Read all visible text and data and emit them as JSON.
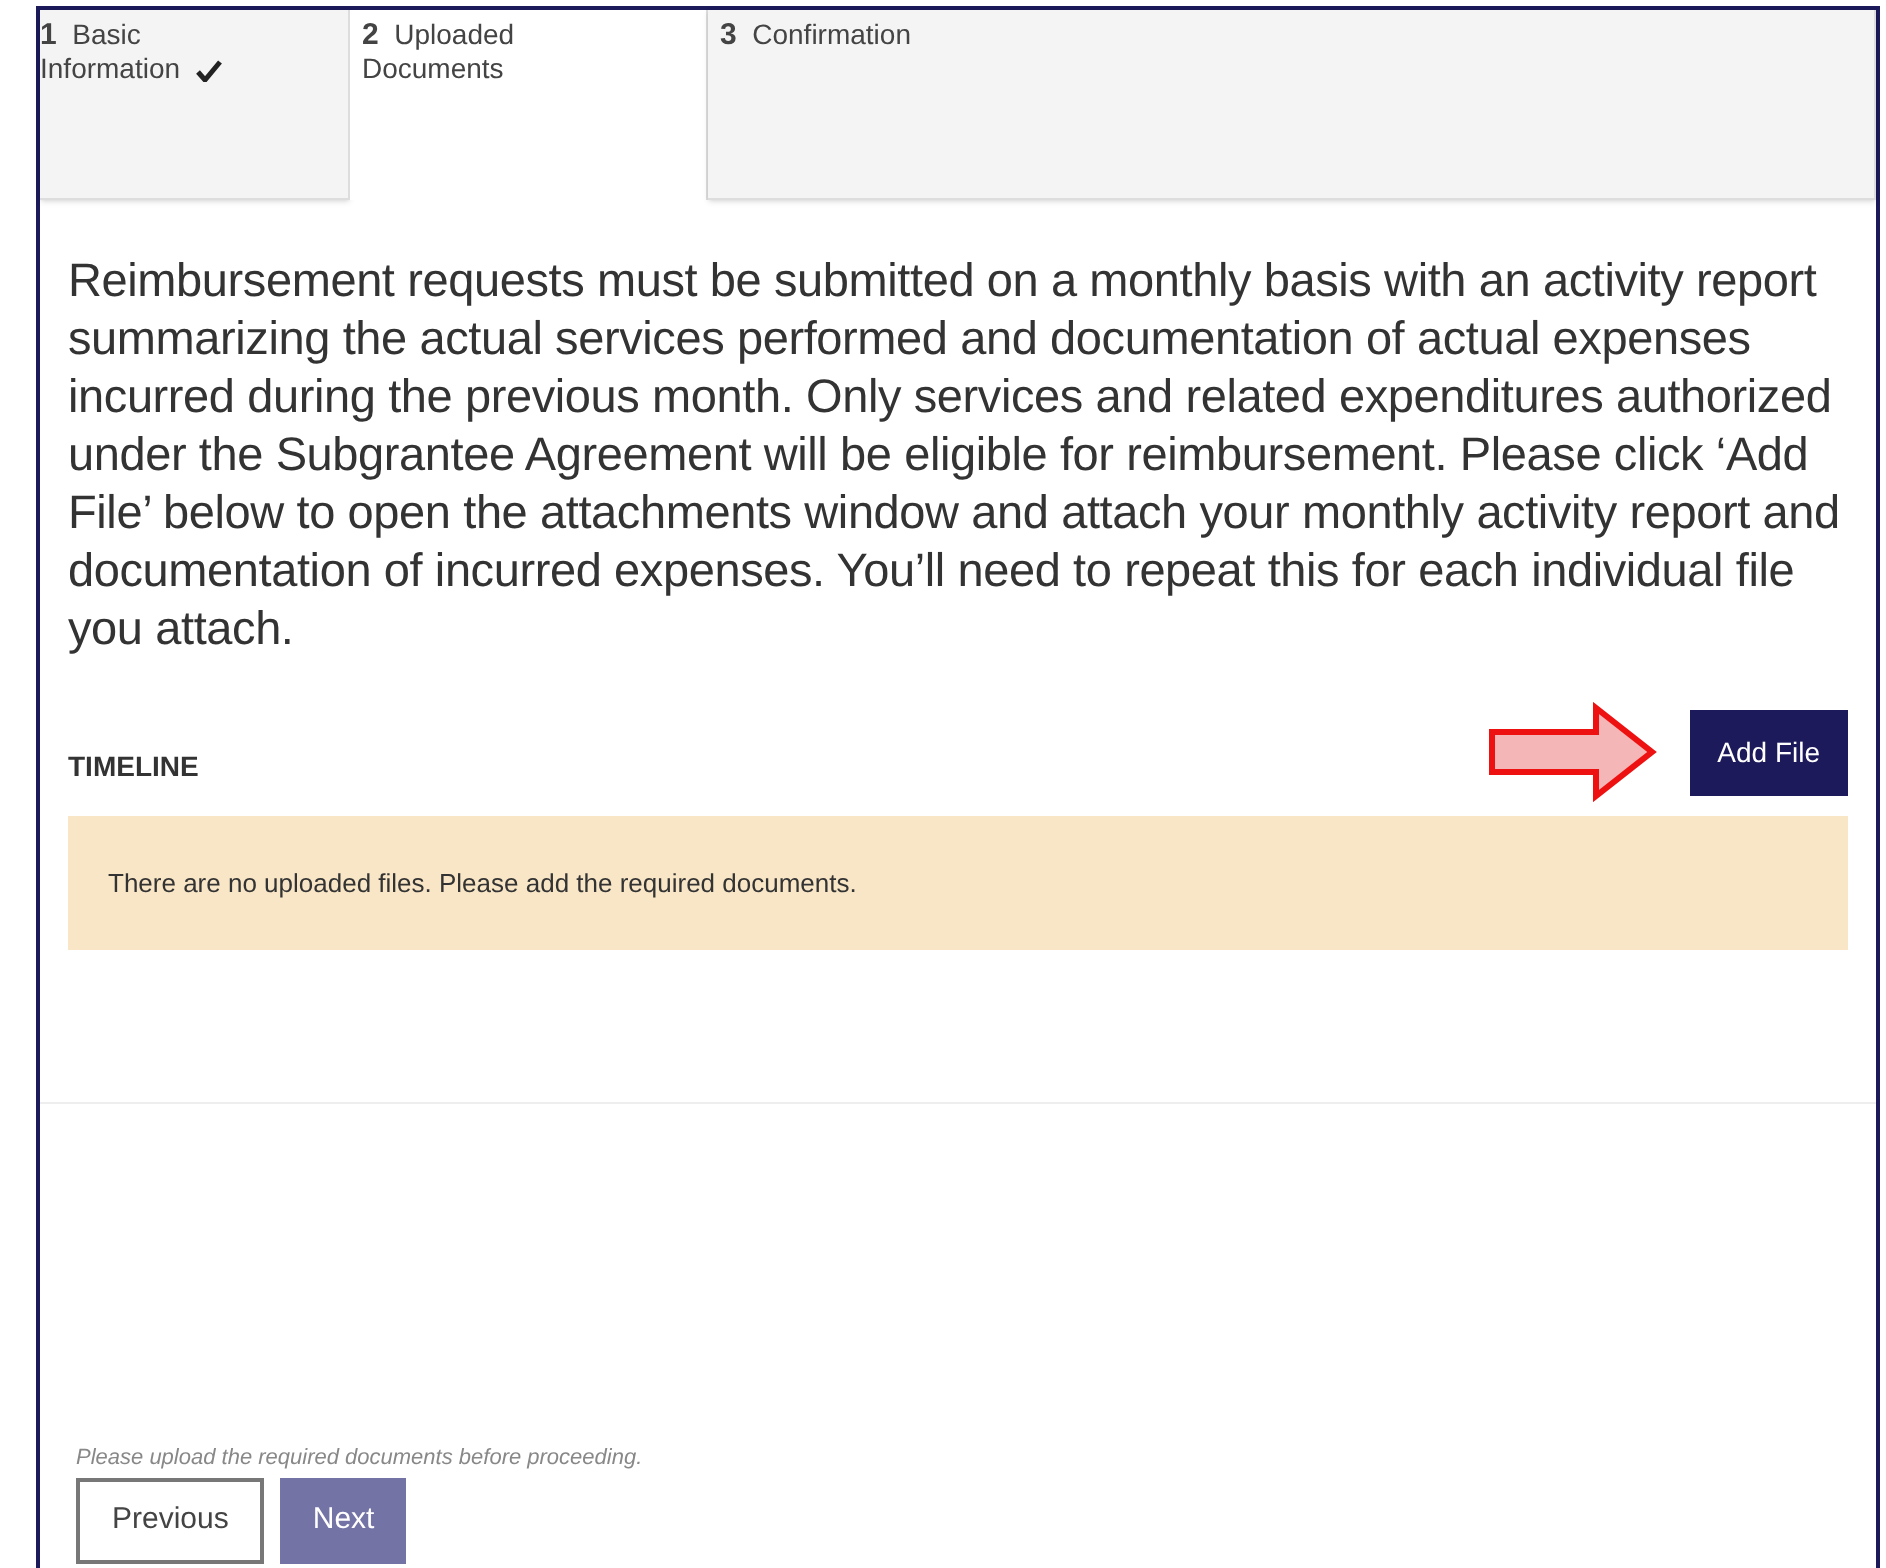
{
  "tabs": [
    {
      "number": "1",
      "label": "Basic Information",
      "completed": true,
      "selected": false
    },
    {
      "number": "2",
      "label": "Uploaded Documents",
      "completed": false,
      "selected": true
    },
    {
      "number": "3",
      "label": "Confirmation",
      "completed": false,
      "selected": false
    }
  ],
  "instructions": "Reimbursement requests must be submitted on a monthly basis with an activity report summarizing the actual services performed and documentation of actual expenses incurred during the previous month. Only services and related expenditures authorized under the Subgrantee Agreement will be eligible for reimbursement. Please click ‘Add File’ below to open the attachments window and attach your monthly activity report and documentation of incurred expenses. You’ll need to repeat this for each individual file you attach.",
  "section_title": "TIMELINE",
  "add_file_button": "Add File",
  "notice": "There are no uploaded files. Please add the required documents.",
  "footer_hint": "Please upload the required documents before proceeding.",
  "buttons": [
    {
      "label": "Previous",
      "kind": "outline",
      "disabled": false
    },
    {
      "label": "Next",
      "kind": "primary",
      "disabled": true
    }
  ]
}
